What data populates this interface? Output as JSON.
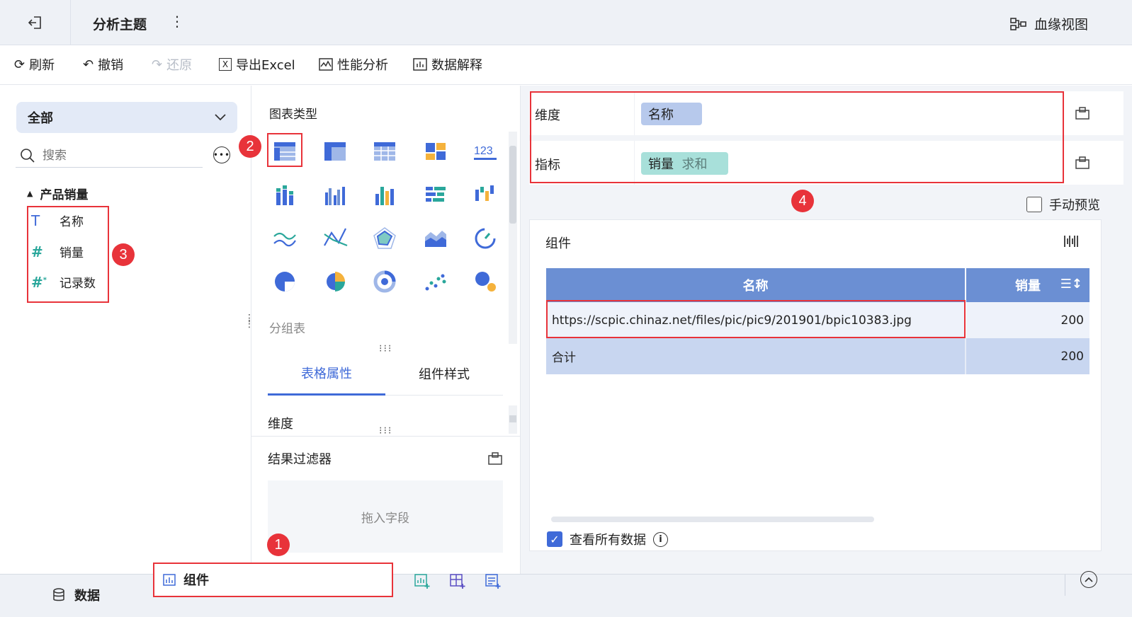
{
  "header": {
    "title": "分析主题",
    "lineage_label": "血缘视图"
  },
  "toolbar": {
    "refresh": "刷新",
    "undo": "撤销",
    "redo": "还原",
    "export": "导出Excel",
    "perf": "性能分析",
    "explain": "数据解释"
  },
  "left": {
    "filter_value": "全部",
    "search_placeholder": "搜索",
    "group_name": "产品销量",
    "fields": [
      {
        "icon": "text-type-icon",
        "label": "名称"
      },
      {
        "icon": "number-type-icon",
        "label": "销量"
      },
      {
        "icon": "count-type-icon",
        "label": "记录数"
      }
    ]
  },
  "middle": {
    "chart_types_title": "图表类型",
    "selected_chart_name": "分组表",
    "tabs": [
      "表格属性",
      "组件样式"
    ],
    "dimension_label": "维度",
    "filter_title": "结果过滤器",
    "drop_placeholder": "拖入字段"
  },
  "right": {
    "dimension_label": "维度",
    "dimension_chip": "名称",
    "metric_label": "指标",
    "metric_chip": "销量",
    "metric_agg": "求和",
    "manual_preview": "手动预览",
    "component_title": "组件",
    "table": {
      "headers": [
        "名称",
        "销量"
      ],
      "rows": [
        [
          "https://scpic.chinaz.net/files/pic/pic9/201901/bpic10383.jpg",
          "200"
        ]
      ],
      "total_label": "合计",
      "total_value": "200"
    },
    "view_all_label": "查看所有数据"
  },
  "bottom": {
    "data_tab": "数据",
    "component_tab": "组件"
  },
  "annotations": [
    "1",
    "2",
    "3",
    "4"
  ],
  "colors": {
    "accent": "#3f6ad8",
    "table_header": "#6b8fd3",
    "dimension_chip": "#b7c9ec",
    "metric_chip": "#a8e0da",
    "highlight": "#e8333a"
  }
}
